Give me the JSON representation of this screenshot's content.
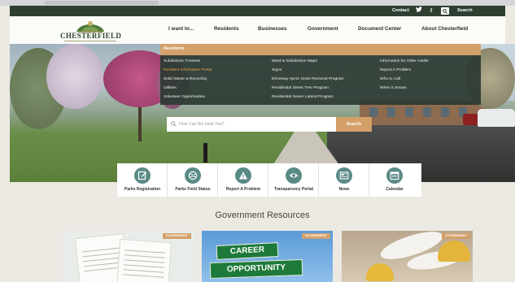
{
  "topbar": {
    "contact": "Contact",
    "search_label": "Search",
    "icons": [
      "twitter-icon",
      "facebook-icon",
      "search-icon"
    ]
  },
  "logo": {
    "text": "CHESTERFIELD"
  },
  "nav": {
    "items": [
      "I want to...",
      "Residents",
      "Businesses",
      "Government",
      "Document Center",
      "About Chesterfield"
    ]
  },
  "mega_menu": {
    "header": "Residents",
    "columns": [
      [
        "Subdivision Trustees",
        "Resident Information Portal",
        "Solid Waste & Recycling",
        "Utilities",
        "Volunteer Opportunities"
      ],
      [
        "Ward & Subdivision Maps",
        "Signs",
        "Driveway Apron Snow Removal Program",
        "Residential Street Tree Program",
        "Residential Sewer Lateral Program"
      ],
      [
        "Information for Older Adults",
        "Report A Problem",
        "Who to Call",
        "When it Snows"
      ]
    ],
    "active_item": "Resident Information Portal"
  },
  "search": {
    "placeholder": "How Can We Help You?",
    "button": "Search"
  },
  "quick_links": [
    {
      "label": "Parks Registration",
      "icon": "edit-icon"
    },
    {
      "label": "Parks Field Status",
      "icon": "ball-icon"
    },
    {
      "label": "Report A Problem",
      "icon": "warning-icon"
    },
    {
      "label": "Transparency Portal",
      "icon": "eye-icon"
    },
    {
      "label": "News",
      "icon": "news-icon"
    },
    {
      "label": "Calendar",
      "icon": "calendar-icon"
    }
  ],
  "government": {
    "title": "Government Resources",
    "cards": [
      {
        "badge": "GOVERNMENT"
      },
      {
        "badge": "GOVERNMENT",
        "sign_top": "CAREER",
        "sign_bottom": "OPPORTUNITY"
      },
      {
        "badge": "GOVERNMENT"
      }
    ]
  },
  "colors": {
    "dark_green": "#2e3f32",
    "accent_tan": "#d4a06a",
    "teal_icon": "#5a8a86"
  }
}
